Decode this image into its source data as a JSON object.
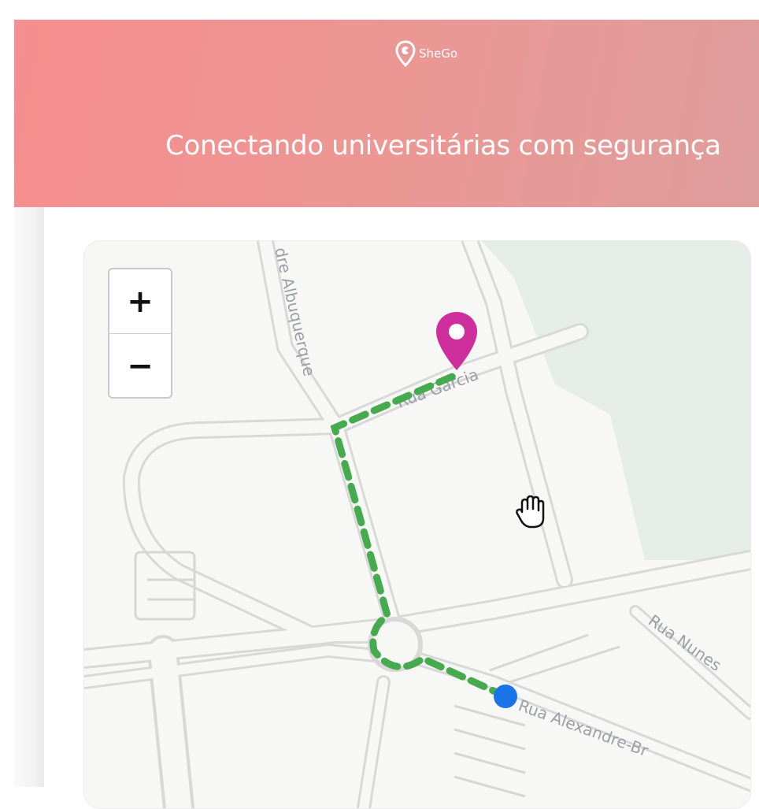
{
  "header": {
    "brand_name": "SheGo",
    "tagline": "Conectando universitárias com segurança",
    "gradient_start": "#f58e8e",
    "gradient_end": "#de9e9c"
  },
  "map": {
    "zoom_in_label": "+",
    "zoom_out_label": "−",
    "streets": {
      "albuquerque": "dre Albuquerque",
      "garcia": "Rua Garcia",
      "nunes": "Rua Nunes",
      "alexandre": "Rua Alexandre-Br"
    },
    "route_color": "#46ab4e",
    "destination_color": "#cf2f9c",
    "origin_color": "#1a73e8",
    "icons": [
      "location-pin-icon",
      "hand-cursor-icon",
      "origin-dot-icon"
    ]
  }
}
